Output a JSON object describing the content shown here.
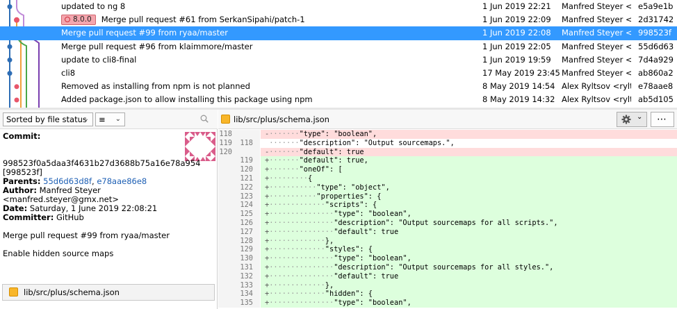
{
  "commits": [
    {
      "message": "updated to ng 8",
      "tag": "",
      "date": "1 Jun 2019 22:21",
      "author": "Manfred Steyer <n",
      "sha": "e5a9e1b",
      "selected": false
    },
    {
      "message": "Merge pull request #61 from SerkanSipahi/patch-1",
      "tag": "8.0.0",
      "date": "1 Jun 2019 22:09",
      "author": "Manfred Steyer <n",
      "sha": "2d31742",
      "selected": false
    },
    {
      "message": "Merge pull request #99 from ryaa/master",
      "tag": "",
      "date": "1 Jun 2019 22:08",
      "author": "Manfred Steyer <n",
      "sha": "998523f",
      "selected": true
    },
    {
      "message": "Merge pull request #96 from klaimmore/master",
      "tag": "",
      "date": "1 Jun 2019 22:05",
      "author": "Manfred Steyer <n",
      "sha": "55d6d63",
      "selected": false
    },
    {
      "message": "update to cli8-final",
      "tag": "",
      "date": "1 Jun 2019 19:59",
      "author": "Manfred Steyer <n",
      "sha": "7d4a929",
      "selected": false
    },
    {
      "message": "cli8",
      "tag": "",
      "date": "17 May 2019 23:45",
      "author": "Manfred Steyer <n",
      "sha": "ab860a2",
      "selected": false
    },
    {
      "message": "Removed as installing from npm is not planned",
      "tag": "",
      "date": "8 May 2019 14:54",
      "author": "Alex Ryltsov <rylts",
      "sha": "e78aae8",
      "selected": false
    },
    {
      "message": "Added package.json to allow installing this package using npm",
      "tag": "",
      "date": "8 May 2019 14:32",
      "author": "Alex Ryltsov <rylts",
      "sha": "ab5d105",
      "selected": false
    }
  ],
  "left_toolbar": {
    "sort_label": "Sorted by file status",
    "view_icon": "list-icon"
  },
  "commit_info": {
    "commit_label": "Commit:",
    "commit_hash": "998523f0a5daa3f4631b27d3688b75a16e78a954",
    "commit_short": "[998523f]",
    "parents_label": "Parents:",
    "parent1": "55d6d63d8f",
    "parent_sep": ", ",
    "parent2": "e78aae86e8",
    "author_label": "Author:",
    "author_name": " Manfred Steyer",
    "author_email": "<manfred.steyer@gmx.net>",
    "date_label": "Date:",
    "date_value": " Saturday, 1 June 2019 22:08:21",
    "committer_label": "Committer:",
    "committer_value": " GitHub",
    "message_title": "Merge pull request #99 from ryaa/master",
    "message_body": "Enable hidden source maps"
  },
  "changed_file": "lib/src/plus/schema.json",
  "right_toolbar": {
    "file_path": "lib/src/plus/schema.json",
    "settings_icon": "gear-icon"
  },
  "diff_lines": [
    {
      "old": "118",
      "new": "",
      "kind": "del",
      "sym": "-",
      "dots": "·······",
      "code": "\"type\": \"boolean\","
    },
    {
      "old": "119",
      "new": "118",
      "kind": "ctx",
      "sym": " ",
      "dots": "·······",
      "code": "\"description\": \"Output sourcemaps.\","
    },
    {
      "old": "120",
      "new": "",
      "kind": "del",
      "sym": "-",
      "dots": "·······",
      "code": "\"default\": true"
    },
    {
      "old": "",
      "new": "119",
      "kind": "add",
      "sym": "+",
      "dots": "·······",
      "code": "\"default\": true,"
    },
    {
      "old": "",
      "new": "120",
      "kind": "add",
      "sym": "+",
      "dots": "·······",
      "code": "\"oneOf\": ["
    },
    {
      "old": "",
      "new": "121",
      "kind": "add",
      "sym": "+",
      "dots": "·········",
      "code": "{"
    },
    {
      "old": "",
      "new": "122",
      "kind": "add",
      "sym": "+",
      "dots": "···········",
      "code": "\"type\": \"object\","
    },
    {
      "old": "",
      "new": "123",
      "kind": "add",
      "sym": "+",
      "dots": "···········",
      "code": "\"properties\": {"
    },
    {
      "old": "",
      "new": "124",
      "kind": "add",
      "sym": "+",
      "dots": "·············",
      "code": "\"scripts\": {"
    },
    {
      "old": "",
      "new": "125",
      "kind": "add",
      "sym": "+",
      "dots": "···············",
      "code": "\"type\": \"boolean\","
    },
    {
      "old": "",
      "new": "126",
      "kind": "add",
      "sym": "+",
      "dots": "···············",
      "code": "\"description\": \"Output sourcemaps for all scripts.\","
    },
    {
      "old": "",
      "new": "127",
      "kind": "add",
      "sym": "+",
      "dots": "···············",
      "code": "\"default\": true"
    },
    {
      "old": "",
      "new": "128",
      "kind": "add",
      "sym": "+",
      "dots": "·············",
      "code": "},"
    },
    {
      "old": "",
      "new": "129",
      "kind": "add",
      "sym": "+",
      "dots": "·············",
      "code": "\"styles\": {"
    },
    {
      "old": "",
      "new": "130",
      "kind": "add",
      "sym": "+",
      "dots": "···············",
      "code": "\"type\": \"boolean\","
    },
    {
      "old": "",
      "new": "131",
      "kind": "add",
      "sym": "+",
      "dots": "···············",
      "code": "\"description\": \"Output sourcemaps for all styles.\","
    },
    {
      "old": "",
      "new": "132",
      "kind": "add",
      "sym": "+",
      "dots": "···············",
      "code": "\"default\": true"
    },
    {
      "old": "",
      "new": "133",
      "kind": "add",
      "sym": "+",
      "dots": "·············",
      "code": "},"
    },
    {
      "old": "",
      "new": "134",
      "kind": "add",
      "sym": "+",
      "dots": "·············",
      "code": "\"hidden\": {"
    },
    {
      "old": "",
      "new": "135",
      "kind": "add",
      "sym": "+",
      "dots": "···············",
      "code": "\"type\": \"boolean\","
    }
  ],
  "colors": {
    "selection": "#3399ff",
    "tag_bg": "#f4a6ae",
    "added_bg": "#ddffdd",
    "removed_bg": "#ffdcdc",
    "link": "#1d5fb4"
  }
}
